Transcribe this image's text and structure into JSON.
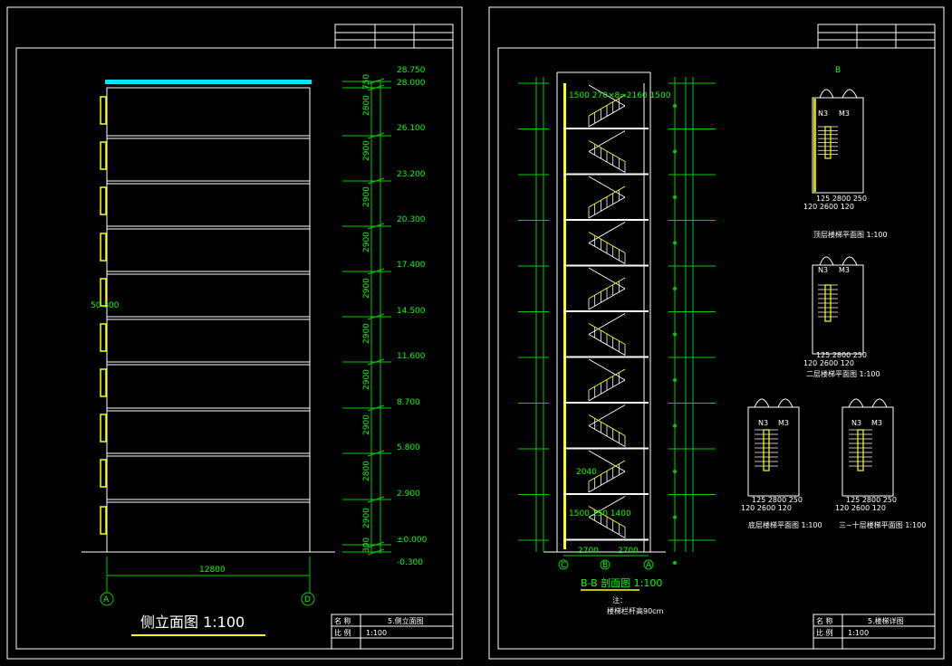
{
  "left_sheet": {
    "elev_labels": [
      "28.750",
      "28.000",
      "26.100",
      "23.200",
      "20.300",
      "17.400",
      "14.500",
      "11.600",
      "8.700",
      "5.800",
      "2.900",
      "±0.000",
      "-0.300"
    ],
    "dim_labels": [
      "750",
      "2800",
      "2900",
      "2900",
      "2900",
      "2900",
      "2900",
      "2900",
      "2900",
      "2800",
      "2900",
      "300"
    ],
    "width_dim": "12800",
    "mark_text": "50   300",
    "axis_a": "A",
    "axis_d": "D",
    "title": "侧立面图 1:100",
    "tb_label_1": "名 称",
    "tb_value_1": "5.侧立面图",
    "tb_label_2": "比 例",
    "tb_value_2": "1:100"
  },
  "right_sheet": {
    "section_title": "B-B 剖面图 1:100",
    "note_label": "注：",
    "note_text": "楼梯栏杆高90cm",
    "dim_top": "1500  270×8=2160  1500",
    "dim_mid": "2040",
    "dim_bot": "1500  250   1400",
    "dim_base_l": "2700",
    "dim_base_r": "2700",
    "axis_c": "C",
    "axis_b": "B",
    "axis_a": "A",
    "room_label_a": "N3",
    "room_label_b": "M3",
    "plan_title_1": "顶层楼梯平面图 1:100",
    "plan_title_2": "二层楼梯平面图 1:100",
    "plan_title_3": "底层楼梯平面图 1:100",
    "plan_title_4": "三~十层楼梯平面图 1:100",
    "plan_dim_1": "125  2800  250",
    "plan_dim_2": "120   2600   120",
    "axis_b_top": "B",
    "tb_label_1": "名 称",
    "tb_value_1": "5.楼梯详图",
    "tb_label_2": "比 例",
    "tb_value_2": "1:100"
  }
}
